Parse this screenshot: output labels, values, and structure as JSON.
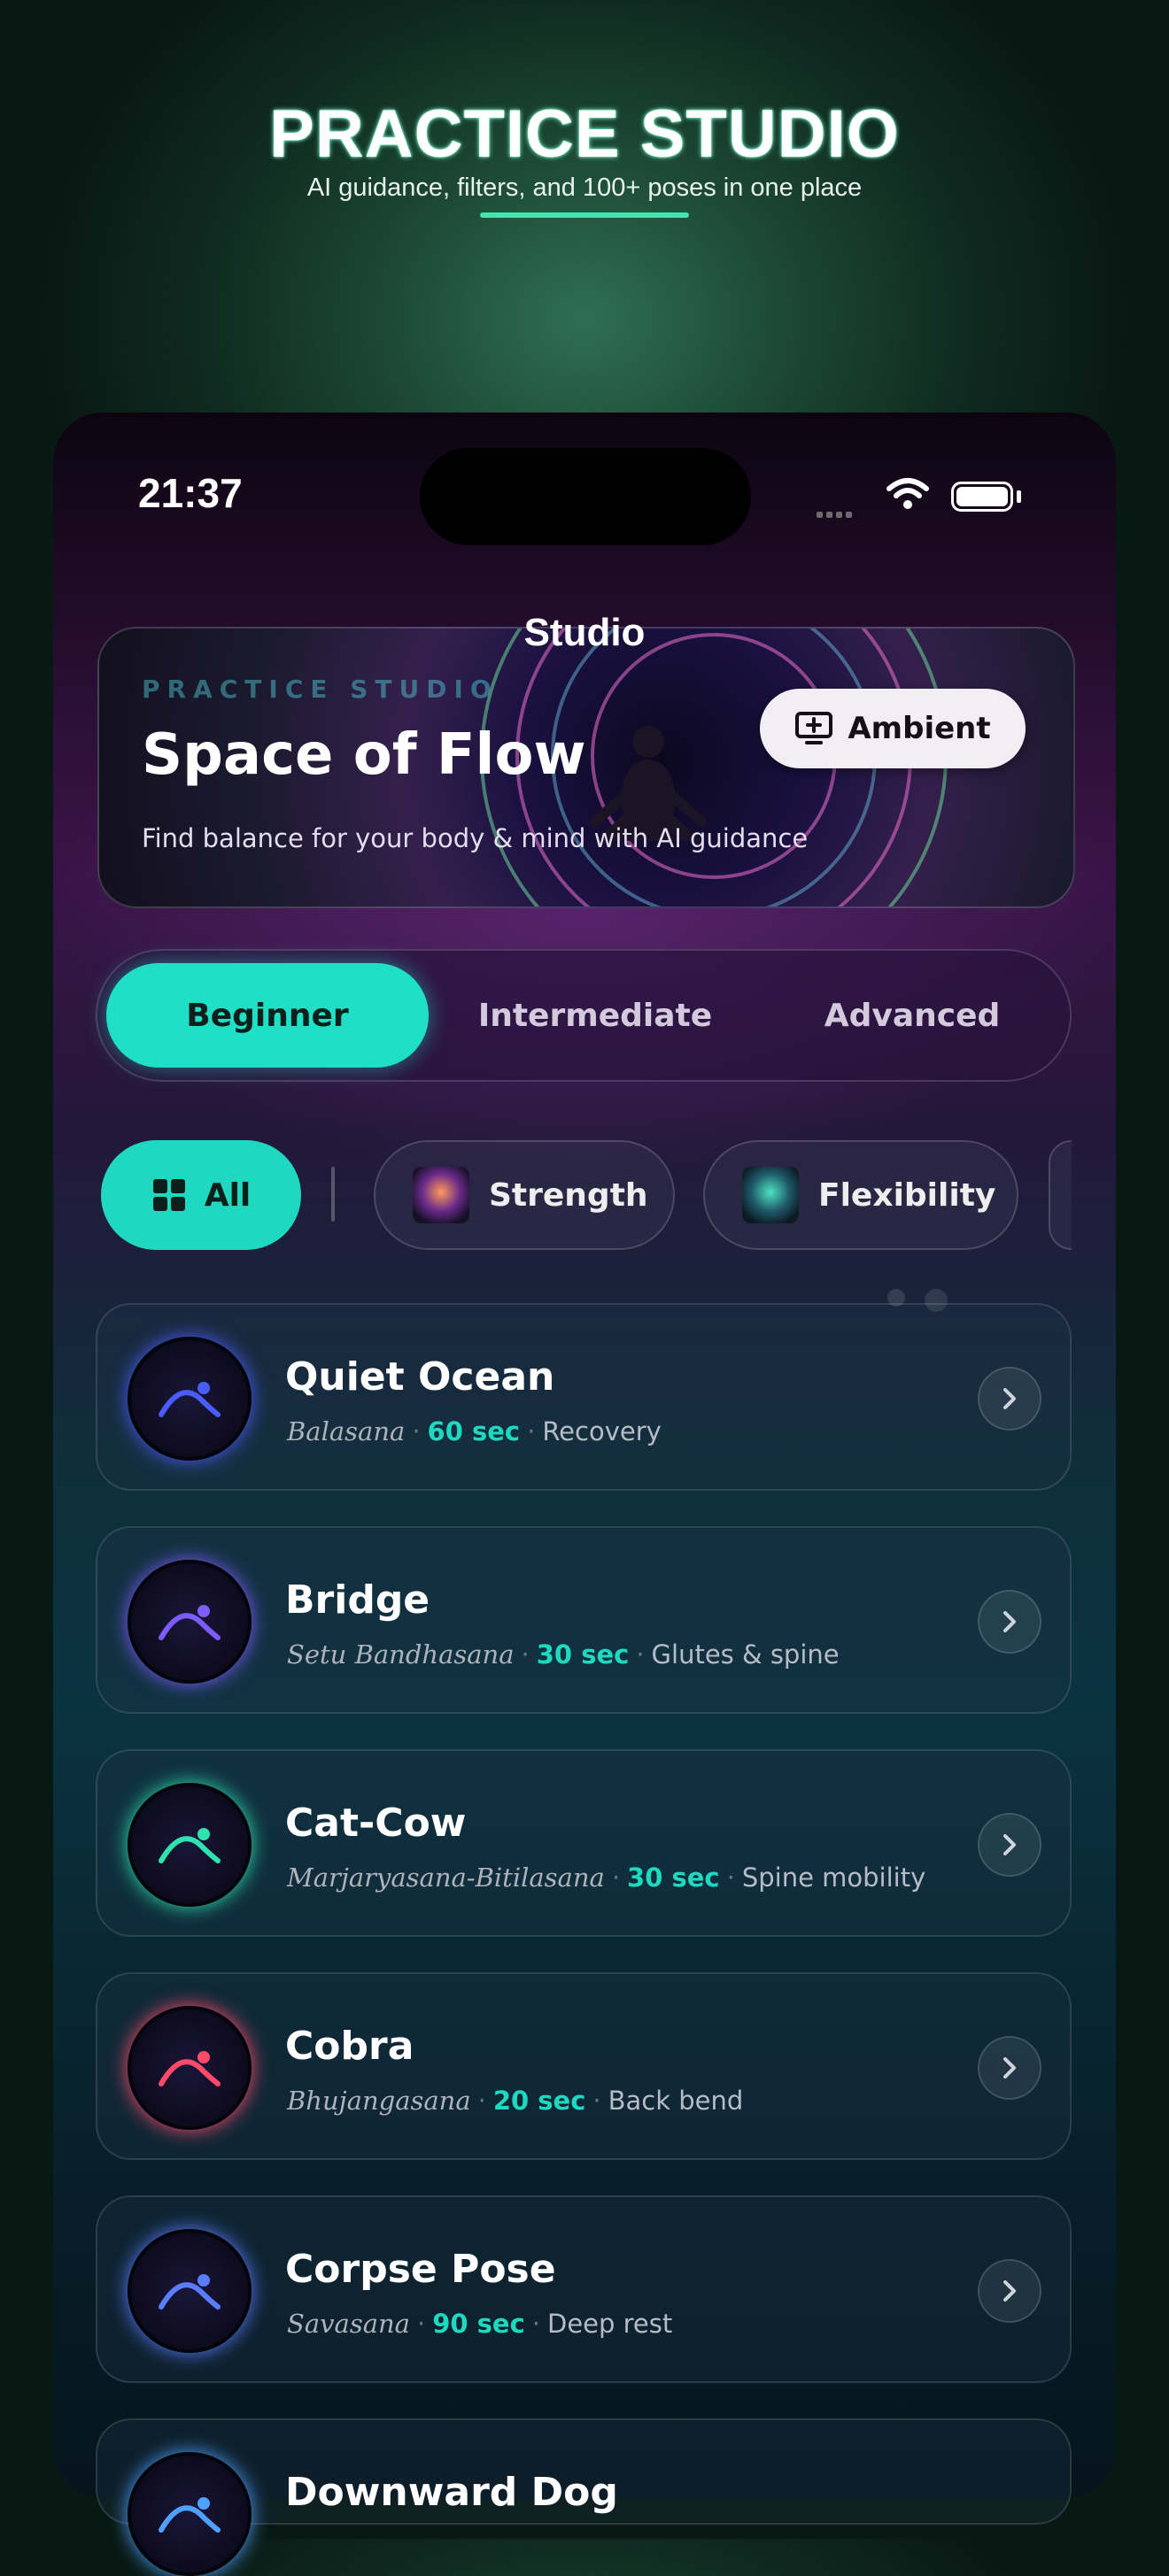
{
  "promo": {
    "title": "PRACTICE STUDIO",
    "subtitle": "AI guidance, filters, and 100+ poses in one place"
  },
  "status_bar": {
    "time": "21:37"
  },
  "nav": {
    "title": "Studio"
  },
  "hero": {
    "kicker": "PRACTICE STUDIO",
    "title": "Space of Flow",
    "description": "Find balance for your body & mind with AI guidance",
    "ambient_label": "Ambient"
  },
  "levels": [
    {
      "label": "Beginner",
      "active": true
    },
    {
      "label": "Intermediate",
      "active": false
    },
    {
      "label": "Advanced",
      "active": false
    }
  ],
  "filters": [
    {
      "label": "All",
      "active": true,
      "icon": "grid-icon"
    },
    {
      "label": "Strength",
      "active": false,
      "icon": "lightning-figure-thumbnail"
    },
    {
      "label": "Flexibility",
      "active": false,
      "icon": "spiral-figure-thumbnail"
    }
  ],
  "poses": [
    {
      "name": "Quiet Ocean",
      "sanskrit": "Balasana",
      "duration": "60 sec",
      "focus": "Recovery",
      "glow": "#4b5cff"
    },
    {
      "name": "Bridge",
      "sanskrit": "Setu Bandhasana",
      "duration": "30 sec",
      "focus": "Glutes & spine",
      "glow": "#7d5cff"
    },
    {
      "name": "Cat-Cow",
      "sanskrit": "Marjaryasana-Bitilasana",
      "duration": "30 sec",
      "focus": "Spine mobility",
      "glow": "#2fe3b0"
    },
    {
      "name": "Cobra",
      "sanskrit": "Bhujangasana",
      "duration": "20 sec",
      "focus": "Back bend",
      "glow": "#ff4a6a"
    },
    {
      "name": "Corpse Pose",
      "sanskrit": "Savasana",
      "duration": "90 sec",
      "focus": "Deep rest",
      "glow": "#5a7dff"
    },
    {
      "name": "Downward Dog",
      "glow": "#4fa0ff"
    }
  ],
  "colors": {
    "accent": "#1fe0c6",
    "background_top": "#3a1447",
    "background_bottom": "#06141c"
  }
}
